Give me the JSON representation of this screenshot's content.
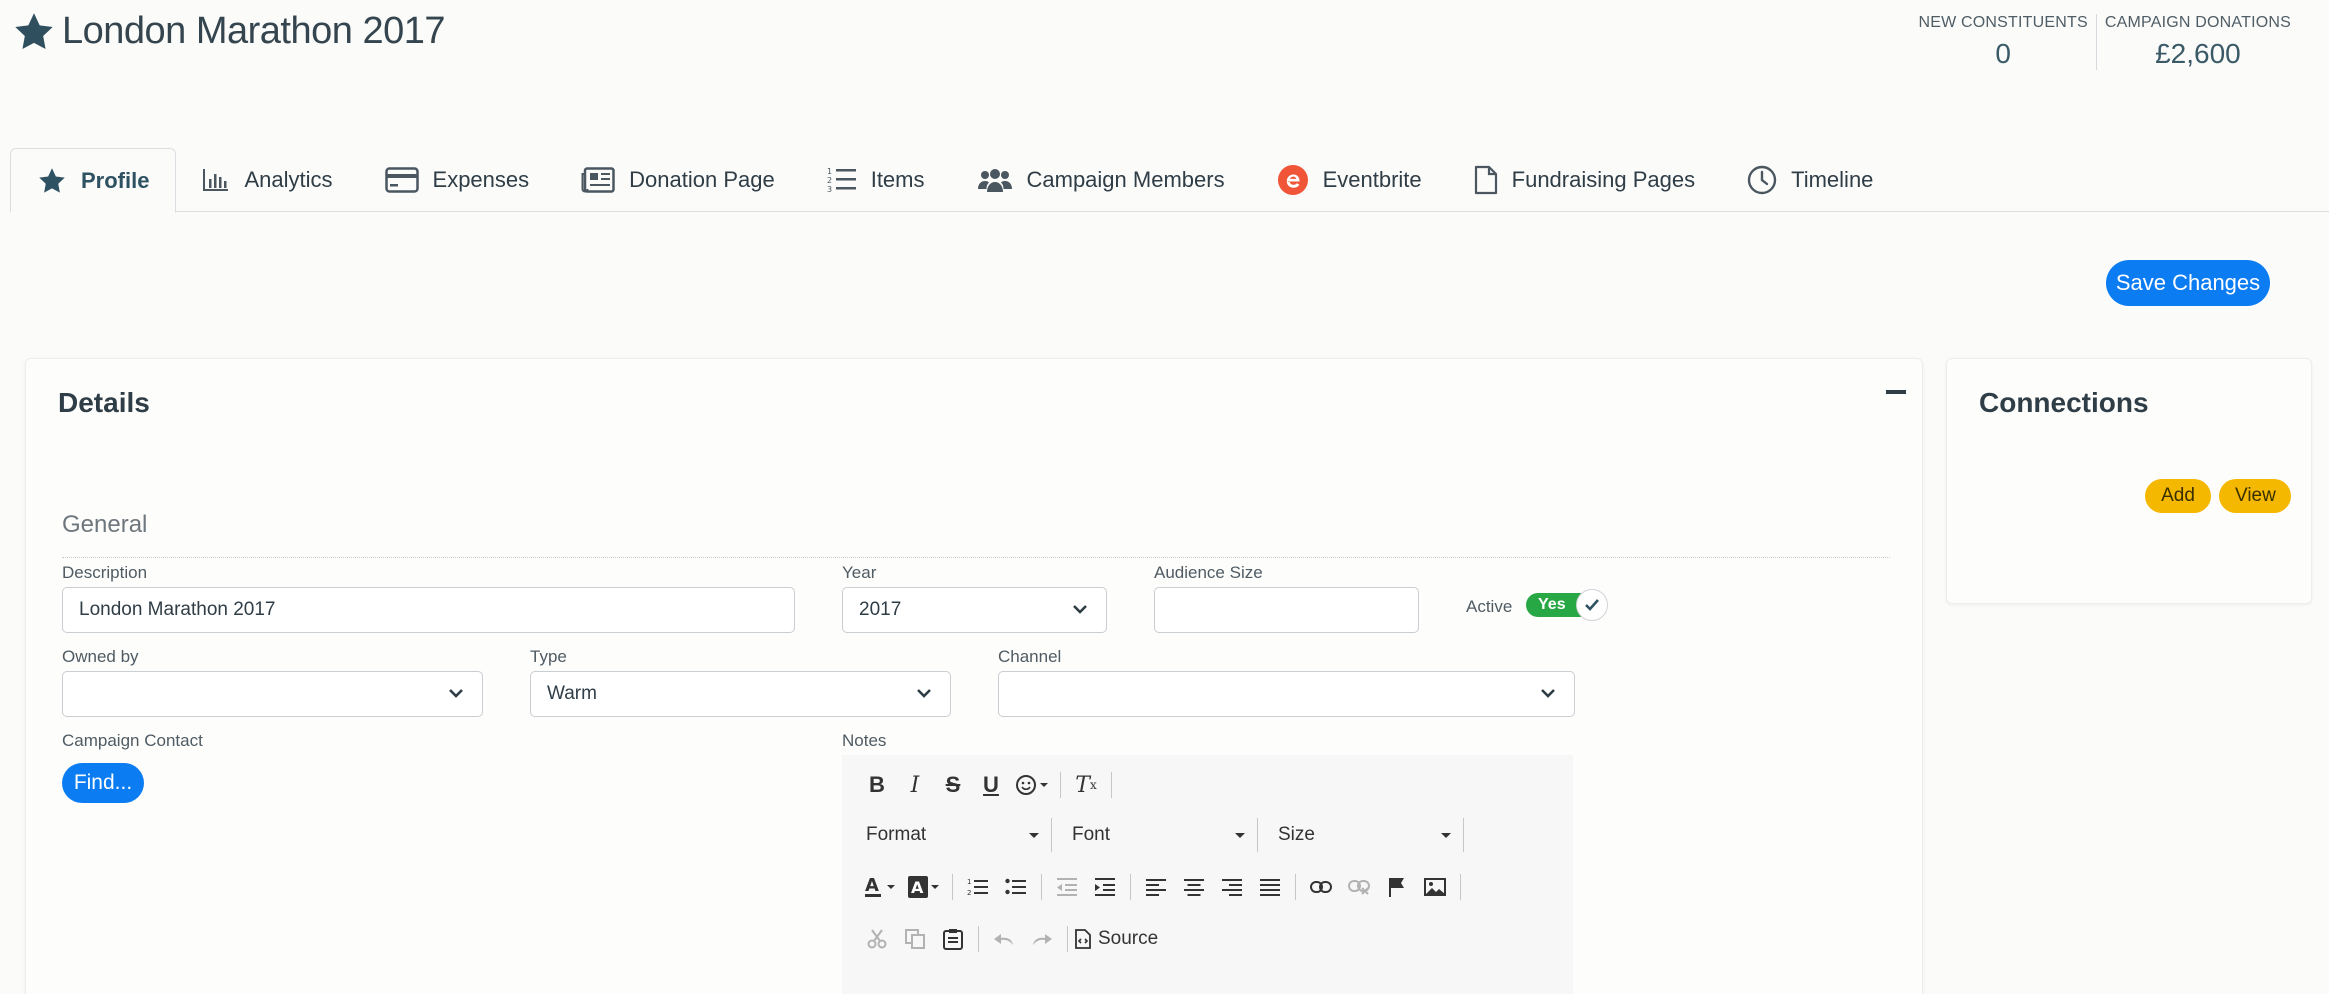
{
  "header": {
    "title": "London Marathon 2017",
    "stats": [
      {
        "label": "NEW CONSTITUENTS",
        "value": "0"
      },
      {
        "label": "CAMPAIGN DONATIONS",
        "value": "£2,600"
      }
    ]
  },
  "tabs": [
    {
      "label": "Profile",
      "icon": "star-icon",
      "active": true
    },
    {
      "label": "Analytics",
      "icon": "bar-chart-icon"
    },
    {
      "label": "Expenses",
      "icon": "credit-card-icon"
    },
    {
      "label": "Donation Page",
      "icon": "newspaper-icon"
    },
    {
      "label": "Items",
      "icon": "numbered-list-icon"
    },
    {
      "label": "Campaign Members",
      "icon": "users-icon"
    },
    {
      "label": "Eventbrite",
      "icon": "eventbrite-icon"
    },
    {
      "label": "Fundraising Pages",
      "icon": "file-icon"
    },
    {
      "label": "Timeline",
      "icon": "clock-icon"
    }
  ],
  "actions": {
    "save_label": "Save Changes"
  },
  "details": {
    "title": "Details",
    "section": "General",
    "fields": {
      "description": {
        "label": "Description",
        "value": "London Marathon 2017"
      },
      "year": {
        "label": "Year",
        "value": "2017"
      },
      "audience_size": {
        "label": "Audience Size",
        "value": ""
      },
      "active": {
        "label": "Active",
        "value": "Yes"
      },
      "owned_by": {
        "label": "Owned by",
        "value": ""
      },
      "type": {
        "label": "Type",
        "value": "Warm"
      },
      "channel": {
        "label": "Channel",
        "value": ""
      },
      "campaign_contact": {
        "label": "Campaign Contact",
        "button": "Find..."
      },
      "notes": {
        "label": "Notes"
      }
    },
    "editor": {
      "format": "Format",
      "font": "Font",
      "size": "Size",
      "source": "Source"
    }
  },
  "connections": {
    "title": "Connections",
    "add_label": "Add",
    "view_label": "View"
  },
  "colors": {
    "accent": "#0b7cf2",
    "toggle": "#28a745",
    "pill": "#f5b800",
    "eventbrite": "#f05537"
  }
}
